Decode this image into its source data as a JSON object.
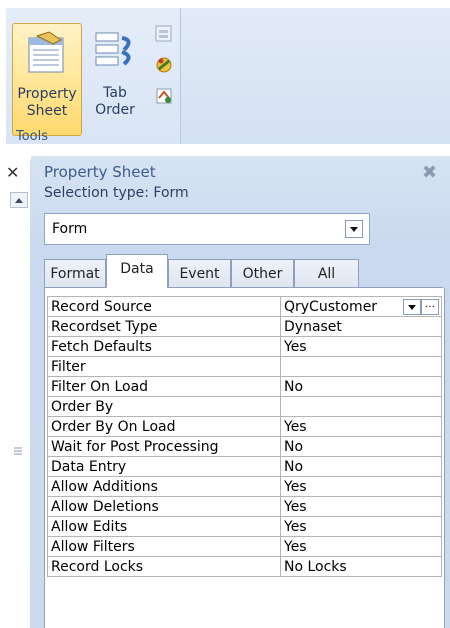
{
  "ribbon": {
    "property_sheet_line1": "Property",
    "property_sheet_line2": "Sheet",
    "tab_order_line1": "Tab",
    "tab_order_line2": "Order",
    "group_label": "Tools"
  },
  "panel": {
    "title": "Property Sheet",
    "close_symbol": "✖",
    "selection_type": "Selection type:  Form",
    "combo_value": "Form",
    "tabs": [
      "Format",
      "Data",
      "Event",
      "Other",
      "All"
    ],
    "active_tab": "Data"
  },
  "gutter": {
    "close_symbol": "✕"
  },
  "properties": [
    {
      "label": "Record Source",
      "value": "QryCustomer"
    },
    {
      "label": "Recordset Type",
      "value": "Dynaset"
    },
    {
      "label": "Fetch Defaults",
      "value": "Yes"
    },
    {
      "label": "Filter",
      "value": ""
    },
    {
      "label": "Filter On Load",
      "value": "No"
    },
    {
      "label": "Order By",
      "value": ""
    },
    {
      "label": "Order By On Load",
      "value": "Yes"
    },
    {
      "label": "Wait for Post Processing",
      "value": "No"
    },
    {
      "label": "Data Entry",
      "value": "No"
    },
    {
      "label": "Allow Additions",
      "value": "Yes"
    },
    {
      "label": "Allow Deletions",
      "value": "Yes"
    },
    {
      "label": "Allow Edits",
      "value": "Yes"
    },
    {
      "label": "Allow Filters",
      "value": "Yes"
    },
    {
      "label": "Record Locks",
      "value": "No Locks"
    }
  ]
}
